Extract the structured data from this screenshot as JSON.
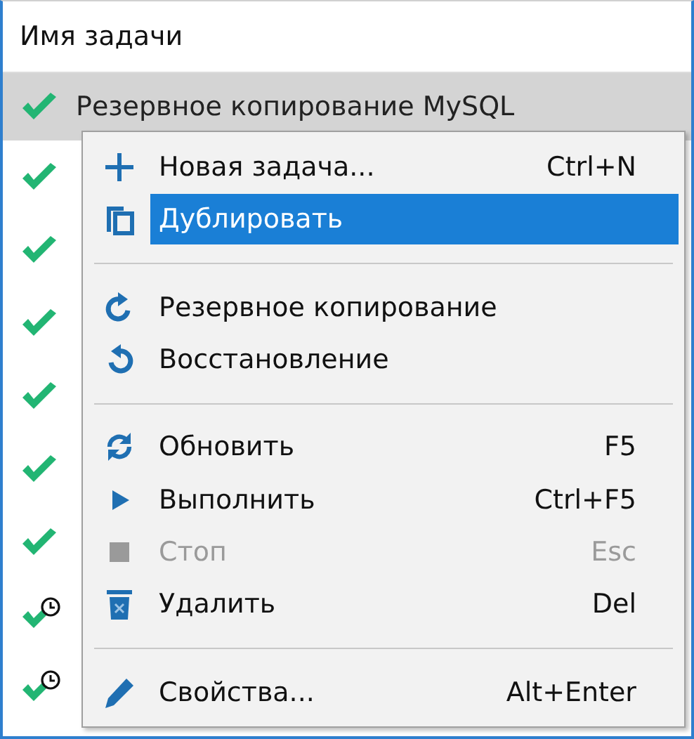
{
  "column_header": "Имя задачи",
  "tasks": [
    {
      "name": "Резервное копирование MySQL",
      "scheduled": false,
      "selected": true
    },
    {
      "scheduled": false,
      "selected": false
    },
    {
      "scheduled": false,
      "selected": false
    },
    {
      "scheduled": false,
      "selected": false
    },
    {
      "scheduled": false,
      "selected": false
    },
    {
      "scheduled": false,
      "selected": false
    },
    {
      "scheduled": false,
      "selected": false
    },
    {
      "scheduled": true,
      "selected": false
    },
    {
      "scheduled": true,
      "selected": false
    }
  ],
  "context_menu": [
    {
      "kind": "item",
      "label": "Новая задача...",
      "shortcut": "Ctrl+N",
      "disabled": false,
      "selected": false
    },
    {
      "kind": "item",
      "label": "Дублировать",
      "disabled": false,
      "selected": true
    },
    {
      "kind": "separator"
    },
    {
      "kind": "item",
      "label": "Резервное копирование",
      "disabled": false,
      "selected": false
    },
    {
      "kind": "item",
      "label": "Восстановление",
      "disabled": false,
      "selected": false
    },
    {
      "kind": "separator"
    },
    {
      "kind": "item",
      "label": "Обновить",
      "shortcut": "F5",
      "disabled": false,
      "selected": false
    },
    {
      "kind": "item",
      "label": "Выполнить",
      "shortcut": "Ctrl+F5",
      "disabled": false,
      "selected": false
    },
    {
      "kind": "item",
      "label": "Стоп",
      "shortcut": "Esc",
      "disabled": true,
      "selected": false
    },
    {
      "kind": "item",
      "label": "Удалить",
      "shortcut": "Del",
      "disabled": false,
      "selected": false
    },
    {
      "kind": "separator"
    },
    {
      "kind": "item",
      "label": "Свойства...",
      "shortcut": "Alt+Enter",
      "disabled": false,
      "selected": false
    }
  ]
}
